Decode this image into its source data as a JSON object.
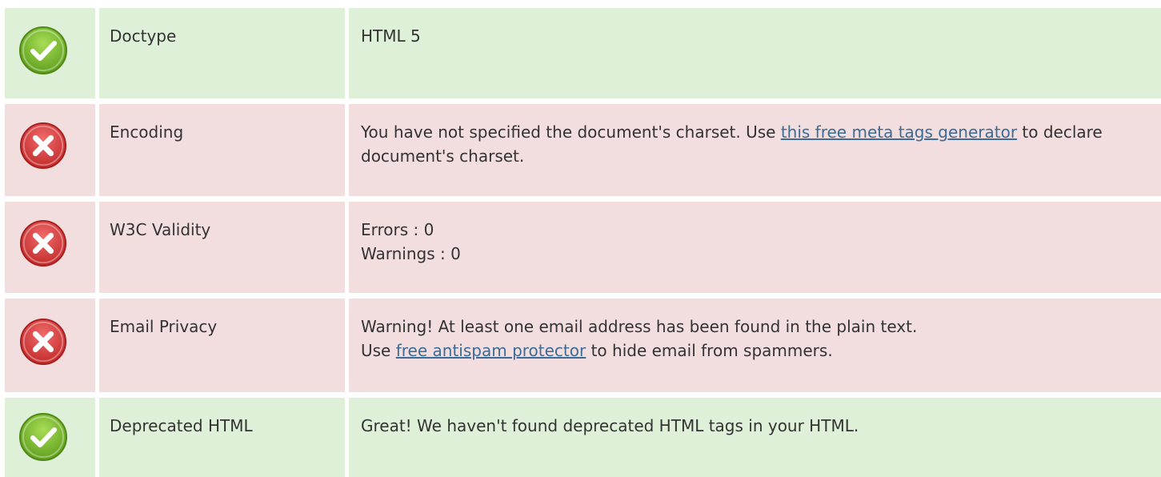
{
  "rows": [
    {
      "status": "pass",
      "icon": "check-circle-icon",
      "label": "Doctype",
      "value": "HTML 5"
    },
    {
      "status": "fail",
      "icon": "x-circle-icon",
      "label": "Encoding",
      "value_before": "You have not specified the document's charset. Use ",
      "link_text": "this free meta tags generator",
      "value_after": " to declare document's charset."
    },
    {
      "status": "fail",
      "icon": "x-circle-icon",
      "label": "W3C Validity",
      "line1": "Errors : 0",
      "line2": "Warnings : 0"
    },
    {
      "status": "fail",
      "icon": "x-circle-icon",
      "label": "Email Privacy",
      "line1": "Warning! At least one email address has been found in the plain text.",
      "value_before": "Use ",
      "link_text": "free antispam protector",
      "value_after": " to hide email from spammers."
    },
    {
      "status": "pass",
      "icon": "check-circle-icon",
      "label": "Deprecated HTML",
      "value": "Great! We haven't found deprecated HTML tags in your HTML."
    }
  ],
  "colors": {
    "pass_bg": "#dff0d8",
    "fail_bg": "#f2dede",
    "link": "#3b6b96",
    "check_green": "#7cb82f",
    "x_red": "#d9383a"
  }
}
